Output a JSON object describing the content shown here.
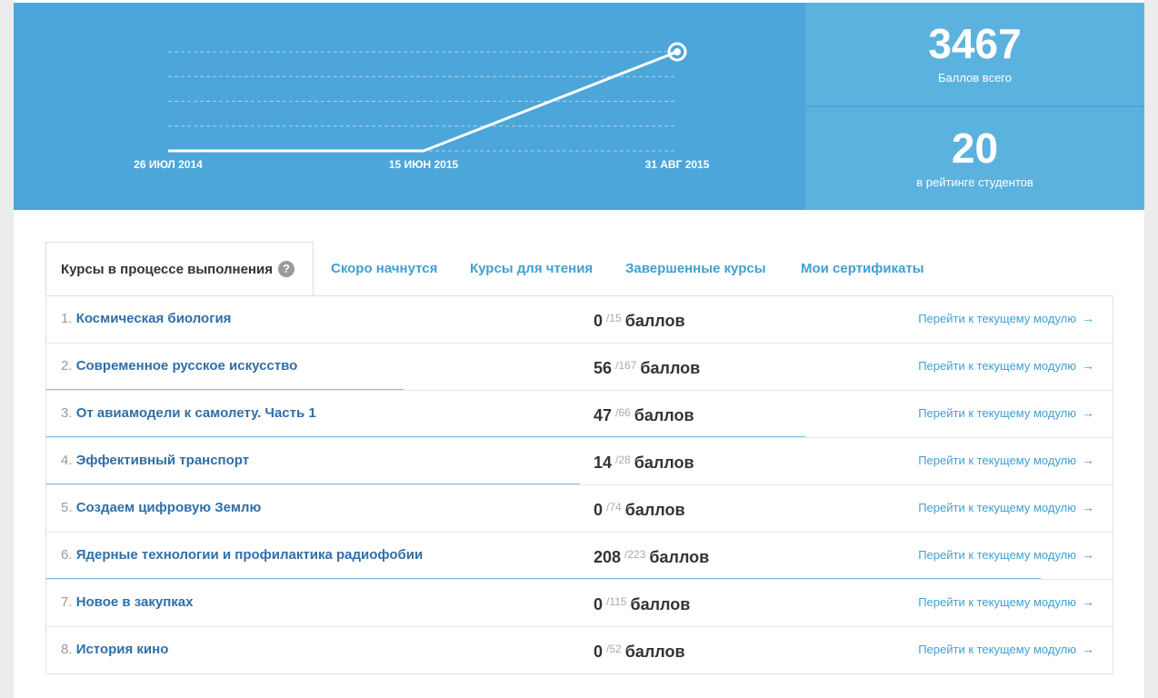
{
  "chart_data": {
    "type": "line",
    "x": [
      "26 ИЮЛ 2014",
      "15 ИЮН 2015",
      "31 АВГ 2015"
    ],
    "tick_labels": [
      "26 ИЮЛ 2014",
      "15 ИЮН 2015",
      "31 АВГ 2015"
    ],
    "series": [
      {
        "values": [
          0,
          0,
          3467
        ]
      }
    ],
    "ylim": [
      0,
      3467
    ],
    "grid": true,
    "colors": {
      "line": "#ffffff",
      "grid": "#a9d4ee"
    }
  },
  "stats": {
    "points_value": "3467",
    "points_label": "Баллов всего",
    "rank_value": "20",
    "rank_label": "в рейтинге студентов"
  },
  "tabs": [
    {
      "label": "Курсы в процессе выполнения",
      "active": true
    },
    {
      "label": "Скоро начнутся"
    },
    {
      "label": "Курсы для чтения"
    },
    {
      "label": "Завершенные курсы"
    },
    {
      "label": "Мои сертификаты"
    }
  ],
  "help_icon": {
    "glyph": "?",
    "icon": "question-circle-icon"
  },
  "courses": [
    {
      "num": "1.",
      "title": "Космическая биология",
      "score": "0",
      "max": "/15",
      "unit": "баллов",
      "progress": 0,
      "link": "Перейти к текущему модулю"
    },
    {
      "num": "2.",
      "title": "Современное русское искусство",
      "score": "56",
      "max": "/167",
      "unit": "баллов",
      "progress": 0.335,
      "link": "Перейти к текущему модулю"
    },
    {
      "num": "3.",
      "title": "От авиамодели к самолету. Часть 1",
      "score": "47",
      "max": "/66",
      "unit": "баллов",
      "progress": 0.712,
      "link": "Перейти к текущему модулю"
    },
    {
      "num": "4.",
      "title": "Эффективный транспорт",
      "score": "14",
      "max": "/28",
      "unit": "баллов",
      "progress": 0.5,
      "link": "Перейти к текущему модулю"
    },
    {
      "num": "5.",
      "title": "Создаем цифровую Землю",
      "score": "0",
      "max": "/74",
      "unit": "баллов",
      "progress": 0,
      "link": "Перейти к текущему модулю"
    },
    {
      "num": "6.",
      "title": "Ядерные технологии и профилактика радиофобии",
      "score": "208",
      "max": "/223",
      "unit": "баллов",
      "progress": 0.933,
      "link": "Перейти к текущему модулю"
    },
    {
      "num": "7.",
      "title": "Новое в закупках",
      "score": "0",
      "max": "/115",
      "unit": "баллов",
      "progress": 0,
      "link": "Перейти к текущему модулю"
    },
    {
      "num": "8.",
      "title": "История кино",
      "score": "0",
      "max": "/52",
      "unit": "баллов",
      "progress": 0,
      "link": "Перейти к текущему модулю"
    }
  ],
  "arrow_glyph": "→"
}
